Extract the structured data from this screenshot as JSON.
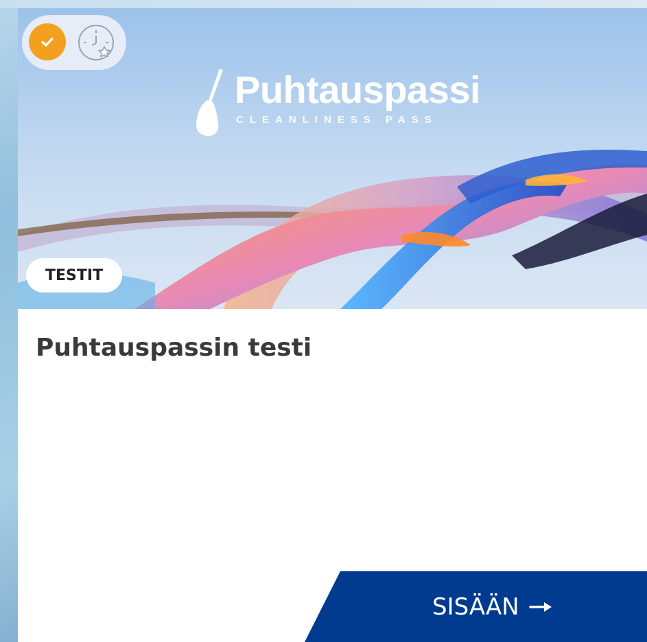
{
  "card": {
    "logo_title": "Puhtauspassi",
    "logo_subtitle": "CLEANLINESS PASS",
    "category": "TESTIT",
    "title": "Puhtauspassin testi",
    "enter_label": "SISÄÄN",
    "status_icons": [
      "check-icon",
      "clock-star-icon"
    ]
  },
  "colors": {
    "check_badge": "#f2a01e",
    "enter_button": "#003b8f",
    "title_text": "#3a3a3a"
  }
}
